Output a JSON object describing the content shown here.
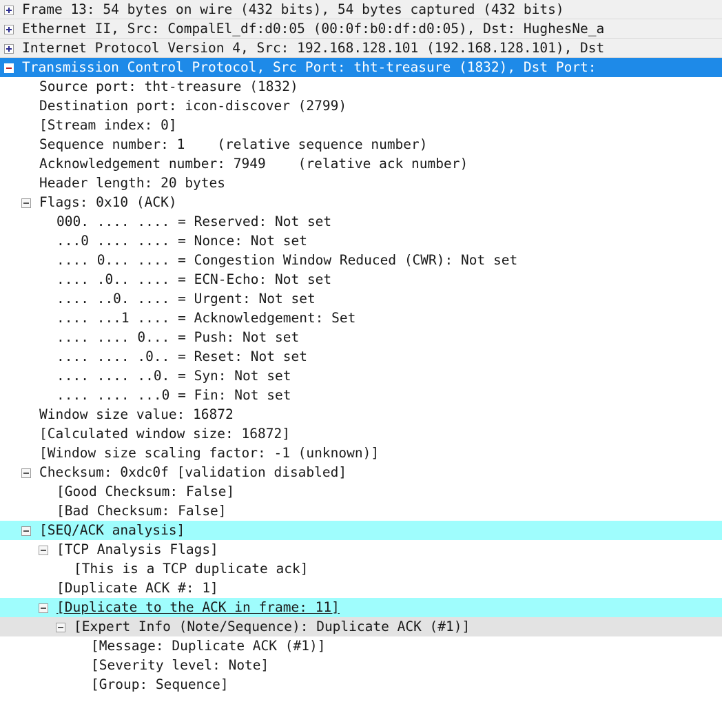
{
  "pane": {
    "name": "packet-details-tree",
    "application": "Wireshark",
    "colors": {
      "selected_row_background": "#1e8ae8",
      "selected_row_text": "#ffffff",
      "highlight_cyan": "#9ffdfd",
      "header_row_background": "#f0f0f0",
      "expert_row_background": "#e3e3e3",
      "default_text": "#1a1a1a"
    }
  },
  "rows": [
    {
      "text": "Frame 13: 54 bytes on wire (432 bits), 54 bytes captured (432 bits)",
      "indent": 0,
      "toggle": "plus",
      "background": "gray",
      "name": "tree-row-frame"
    },
    {
      "text": "Ethernet II, Src: CompalEl_df:d0:05 (00:0f:b0:df:d0:05), Dst: HughesNe_a",
      "indent": 0,
      "toggle": "plus",
      "background": "gray",
      "name": "tree-row-ethernet"
    },
    {
      "text": "Internet Protocol Version 4, Src: 192.168.128.101 (192.168.128.101), Dst",
      "indent": 0,
      "toggle": "plus",
      "background": "gray",
      "name": "tree-row-ipv4"
    },
    {
      "text": "Transmission Control Protocol, Src Port: tht-treasure (1832), Dst Port:",
      "indent": 0,
      "toggle": "minus",
      "background": "selected",
      "name": "tree-row-tcp"
    },
    {
      "text": "Source port: tht-treasure (1832)",
      "indent": 1,
      "toggle": "none",
      "background": "white",
      "name": "tree-row-source-port"
    },
    {
      "text": "Destination port: icon-discover (2799)",
      "indent": 1,
      "toggle": "none",
      "background": "white",
      "name": "tree-row-destination-port"
    },
    {
      "text": "[Stream index: 0]",
      "indent": 1,
      "toggle": "none",
      "background": "white",
      "name": "tree-row-stream-index"
    },
    {
      "text": "Sequence number: 1    (relative sequence number)",
      "indent": 1,
      "toggle": "none",
      "background": "white",
      "name": "tree-row-sequence-number"
    },
    {
      "text": "Acknowledgement number: 7949    (relative ack number)",
      "indent": 1,
      "toggle": "none",
      "background": "white",
      "name": "tree-row-acknowledgement-number"
    },
    {
      "text": "Header length: 20 bytes",
      "indent": 1,
      "toggle": "none",
      "background": "white",
      "name": "tree-row-header-length"
    },
    {
      "text": "Flags: 0x10 (ACK)",
      "indent": 1,
      "toggle": "minus",
      "background": "white",
      "name": "tree-row-flags"
    },
    {
      "text": "000. .... .... = Reserved: Not set",
      "indent": 2,
      "toggle": "none",
      "background": "white",
      "name": "tree-row-flag-reserved"
    },
    {
      "text": "...0 .... .... = Nonce: Not set",
      "indent": 2,
      "toggle": "none",
      "background": "white",
      "name": "tree-row-flag-nonce"
    },
    {
      "text": ".... 0... .... = Congestion Window Reduced (CWR): Not set",
      "indent": 2,
      "toggle": "none",
      "background": "white",
      "name": "tree-row-flag-cwr"
    },
    {
      "text": ".... .0.. .... = ECN-Echo: Not set",
      "indent": 2,
      "toggle": "none",
      "background": "white",
      "name": "tree-row-flag-ecn-echo"
    },
    {
      "text": ".... ..0. .... = Urgent: Not set",
      "indent": 2,
      "toggle": "none",
      "background": "white",
      "name": "tree-row-flag-urgent"
    },
    {
      "text": ".... ...1 .... = Acknowledgement: Set",
      "indent": 2,
      "toggle": "none",
      "background": "white",
      "name": "tree-row-flag-acknowledgement"
    },
    {
      "text": ".... .... 0... = Push: Not set",
      "indent": 2,
      "toggle": "none",
      "background": "white",
      "name": "tree-row-flag-push"
    },
    {
      "text": ".... .... .0.. = Reset: Not set",
      "indent": 2,
      "toggle": "none",
      "background": "white",
      "name": "tree-row-flag-reset"
    },
    {
      "text": ".... .... ..0. = Syn: Not set",
      "indent": 2,
      "toggle": "none",
      "background": "white",
      "name": "tree-row-flag-syn"
    },
    {
      "text": ".... .... ...0 = Fin: Not set",
      "indent": 2,
      "toggle": "none",
      "background": "white",
      "name": "tree-row-flag-fin"
    },
    {
      "text": "Window size value: 16872",
      "indent": 1,
      "toggle": "none",
      "background": "white",
      "name": "tree-row-window-size-value"
    },
    {
      "text": "[Calculated window size: 16872]",
      "indent": 1,
      "toggle": "none",
      "background": "white",
      "name": "tree-row-calculated-window-size"
    },
    {
      "text": "[Window size scaling factor: -1 (unknown)]",
      "indent": 1,
      "toggle": "none",
      "background": "white",
      "name": "tree-row-window-scaling-factor"
    },
    {
      "text": "Checksum: 0xdc0f [validation disabled]",
      "indent": 1,
      "toggle": "minus",
      "background": "white",
      "name": "tree-row-checksum"
    },
    {
      "text": "[Good Checksum: False]",
      "indent": 2,
      "toggle": "none",
      "background": "white",
      "name": "tree-row-good-checksum"
    },
    {
      "text": "[Bad Checksum: False]",
      "indent": 2,
      "toggle": "none",
      "background": "white",
      "name": "tree-row-bad-checksum"
    },
    {
      "text": "[SEQ/ACK analysis]",
      "indent": 1,
      "toggle": "minus",
      "background": "cyan",
      "name": "tree-row-seq-ack-analysis"
    },
    {
      "text": "[TCP Analysis Flags]",
      "indent": 2,
      "toggle": "minus",
      "background": "white",
      "name": "tree-row-tcp-analysis-flags"
    },
    {
      "text": "[This is a TCP duplicate ack]",
      "indent": 3,
      "toggle": "none",
      "background": "white",
      "name": "tree-row-tcp-duplicate-ack"
    },
    {
      "text": "[Duplicate ACK #: 1]",
      "indent": 2,
      "toggle": "none",
      "background": "white",
      "name": "tree-row-duplicate-ack-number"
    },
    {
      "text": "[Duplicate to the ACK in frame: 11]",
      "indent": 2,
      "toggle": "minus",
      "background": "cyan",
      "link": true,
      "name": "tree-row-duplicate-to-ack-frame-link"
    },
    {
      "text": "[Expert Info (Note/Sequence): Duplicate ACK (#1)]",
      "indent": 3,
      "toggle": "minus",
      "background": "expert",
      "name": "tree-row-expert-info"
    },
    {
      "text": "[Message: Duplicate ACK (#1)]",
      "indent": 4,
      "toggle": "none",
      "background": "white",
      "name": "tree-row-expert-message"
    },
    {
      "text": "[Severity level: Note]",
      "indent": 4,
      "toggle": "none",
      "background": "white",
      "name": "tree-row-expert-severity"
    },
    {
      "text": "[Group: Sequence]",
      "indent": 4,
      "toggle": "none",
      "background": "white",
      "name": "tree-row-expert-group"
    }
  ]
}
